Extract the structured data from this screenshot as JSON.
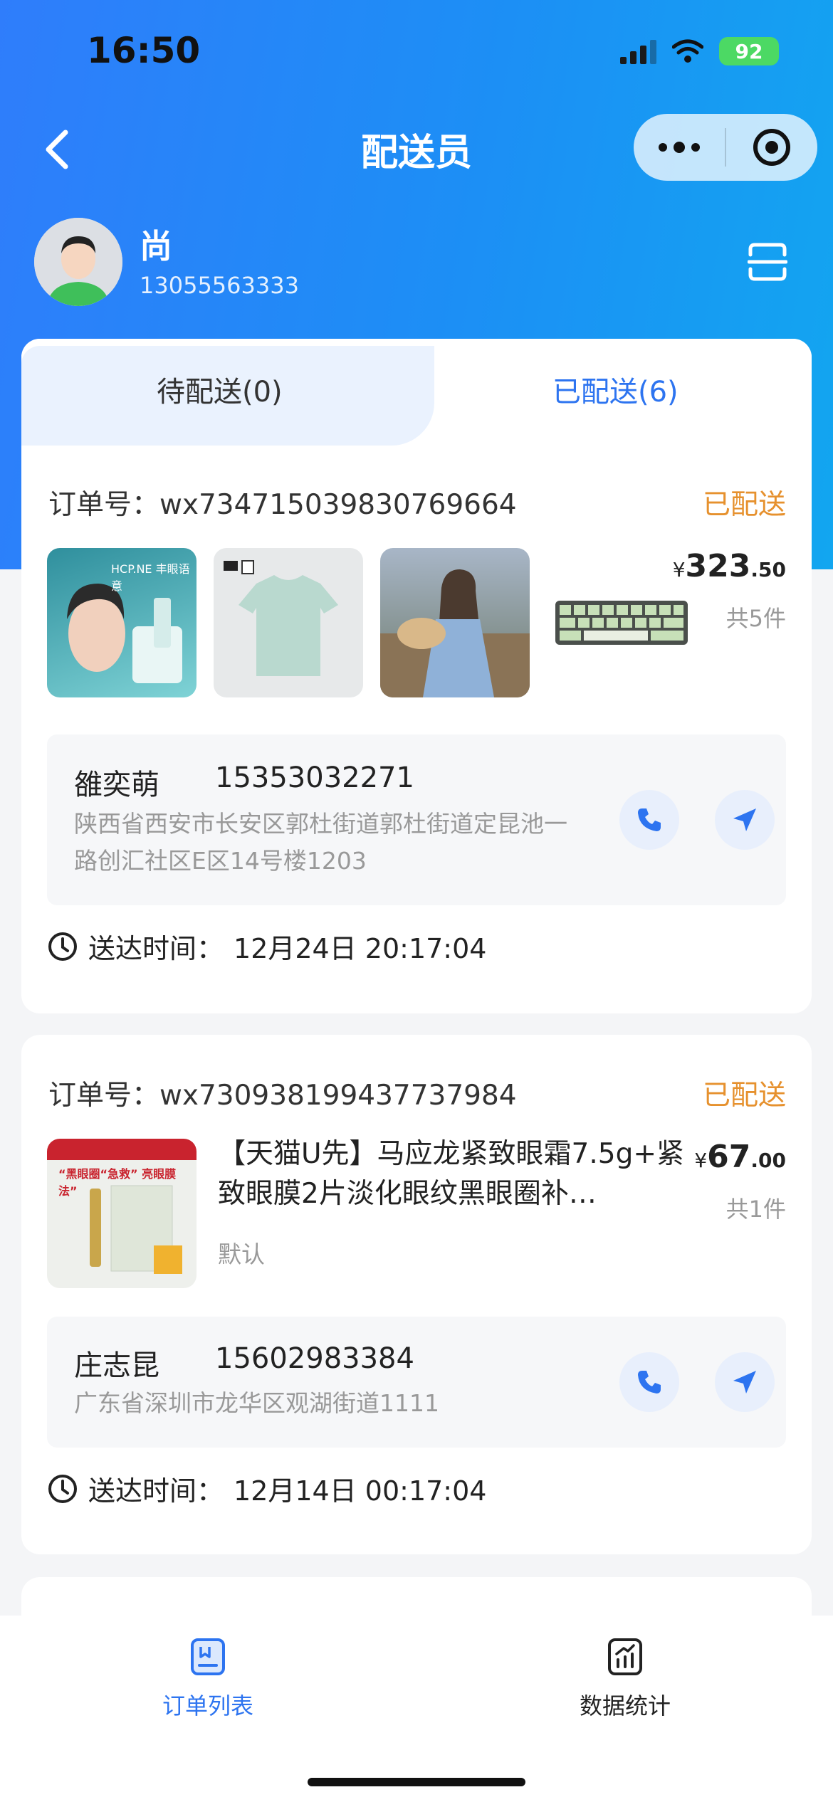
{
  "status_bar": {
    "time": "16:50",
    "battery": "92"
  },
  "nav": {
    "title": "配送员"
  },
  "profile": {
    "name": "尚",
    "phone": "13055563333"
  },
  "tabs": [
    {
      "label": "待配送(0)"
    },
    {
      "label": "已配送(6)"
    }
  ],
  "orders": [
    {
      "order_no": "订单号：wx734715039830769664",
      "status": "已配送",
      "price_symbol": "¥",
      "price_int": "323",
      "price_dec": ".50",
      "count": "共5件",
      "contact_name": "雒奕萌",
      "contact_phone": "15353032271",
      "address": "陕西省西安市长安区郭杜街道郭杜街道定昆池一路创汇社区E区14号楼1203",
      "delivered_label": "送达时间：",
      "delivered_time": "12月24日 20:17:04",
      "thumb_caption": "HCP.NE 丰眼语意"
    },
    {
      "order_no": "订单号：wx730938199437737984",
      "status": "已配送",
      "price_symbol": "¥",
      "price_int": "67",
      "price_dec": ".00",
      "count": "共1件",
      "product_title": "【天猫U先】马应龙紧致眼霜7.5g+紧致眼膜2片淡化眼纹黑眼圈补…",
      "product_sku": "默认",
      "contact_name": "庄志昆",
      "contact_phone": "15602983384",
      "address": "广东省深圳市龙华区观湖街道1111",
      "delivered_label": "送达时间：",
      "delivered_time": "12月14日 00:17:04",
      "thumb_caption": "“黑眼圈“急救” 亮眼膜法”"
    }
  ],
  "tabbar": [
    {
      "label": "订单列表",
      "icon": "order-list-icon",
      "active": true
    },
    {
      "label": "数据统计",
      "icon": "stats-icon",
      "active": false
    }
  ],
  "colors": {
    "accent": "#2d74f0",
    "status": "#e6912e",
    "hero": "#1c8ff5"
  }
}
